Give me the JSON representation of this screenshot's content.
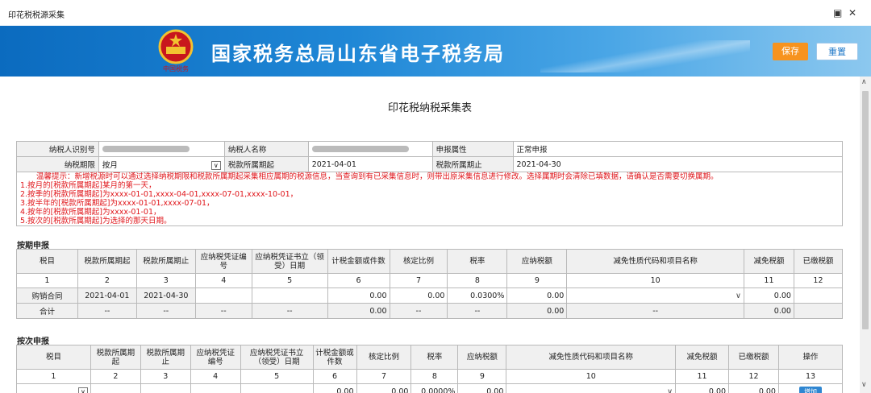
{
  "window": {
    "title": "印花税税源采集"
  },
  "banner": {
    "title": "国家税务总局山东省电子税务局",
    "emblem_caption": "中国税务"
  },
  "toolbar": {
    "save_label": "保存",
    "reset_label": "重置"
  },
  "form": {
    "title": "印花税纳税采集表",
    "taxpayer_id_label": "纳税人识别号",
    "taxpayer_name_label": "纳税人名称",
    "declare_attr_label": "申报属性",
    "declare_attr_value": "正常申报",
    "period_label": "纳税期限",
    "period_value": "按月",
    "start_label": "税款所属期起",
    "start_value": "2021-04-01",
    "end_label": "税款所属期止",
    "end_value": "2021-04-30",
    "notice": [
      "温馨提示：新增税源时可以通过选择纳税期限和税款所属期起采集相应属期的税源信息，当查询到有已采集信息时，则带出原采集信息进行修改。选择属期时会清除已填数据，请确认是否需要切换属期。",
      "1.按月的[税款所属期起]某月的第一天，",
      "2.按季的[税款所属期起]为xxxx-01-01,xxxx-04-01,xxxx-07-01,xxxx-10-01，",
      "3.按半年的[税款所属期起]为xxxx-01-01,xxxx-07-01，",
      "4.按年的[税款所属期起]为xxxx-01-01，",
      "5.按次的[税款所属期起]为选择的那天日期。"
    ]
  },
  "periodic": {
    "section_title": "按期申报",
    "headers": [
      "税目",
      "税款所属期起",
      "税款所属期止",
      "应纳税凭证编号",
      "应纳税凭证书立（领受）日期",
      "计税金额或件数",
      "核定比例",
      "税率",
      "应纳税额",
      "减免性质代码和项目名称",
      "减免税额",
      "已缴税额"
    ],
    "numbers": [
      "1",
      "2",
      "3",
      "4",
      "5",
      "6",
      "7",
      "8",
      "9",
      "10",
      "11",
      "12"
    ],
    "row": {
      "item": "购销合同",
      "start": "2021-04-01",
      "end": "2021-04-30",
      "amount": "0.00",
      "ratio": "0.00",
      "rate": "0.0300%",
      "tax": "0.00",
      "relief": "0.00"
    },
    "total": {
      "label": "合计",
      "dash": "--",
      "amount": "0.00",
      "tax": "0.00",
      "relief": "0.00"
    }
  },
  "per_time": {
    "section_title": "按次申报",
    "headers": [
      "税目",
      "税款所属期起",
      "税款所属期止",
      "应纳税凭证编号",
      "应纳税凭证书立（领受）日期",
      "计税金额或件数",
      "核定比例",
      "税率",
      "应纳税额",
      "减免性质代码和项目名称",
      "减免税额",
      "已缴税额",
      "操作"
    ],
    "numbers": [
      "1",
      "2",
      "3",
      "4",
      "5",
      "6",
      "7",
      "8",
      "9",
      "10",
      "11",
      "12",
      "13"
    ],
    "partial_row": {
      "amount": "0.00",
      "ratio": "0.00",
      "rate": "0.0000%",
      "tax": "0.00",
      "relief": "0.00",
      "paid": "0.00",
      "action": "增加"
    }
  }
}
